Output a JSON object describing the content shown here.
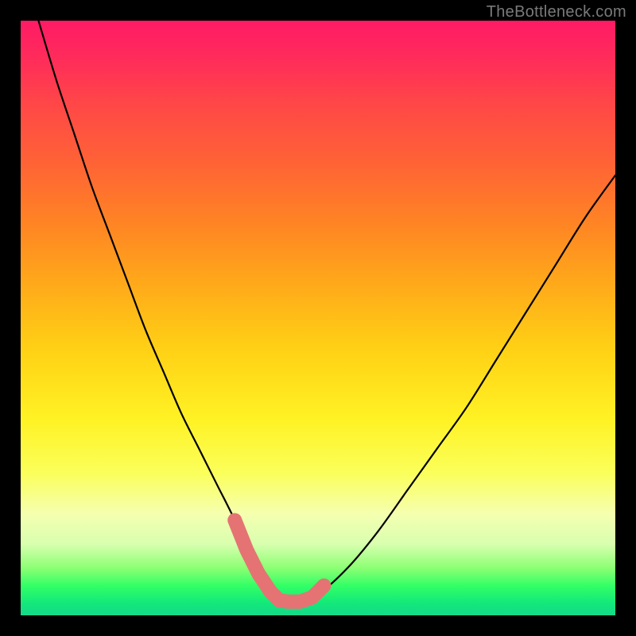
{
  "watermark": "TheBottleneck.com",
  "colors": {
    "page_bg": "#000000",
    "curve": "#000000",
    "marker": "#e57373",
    "watermark": "#7a7a7a"
  },
  "chart_data": {
    "type": "line",
    "title": "",
    "xlabel": "",
    "ylabel": "",
    "xlim": [
      0,
      100
    ],
    "ylim": [
      0,
      100
    ],
    "grid": false,
    "legend": false,
    "series": [
      {
        "name": "bottleneck-curve",
        "x": [
          3,
          6,
          9,
          12,
          15,
          18,
          21,
          24,
          27,
          30,
          33,
          36,
          38,
          40,
          42,
          43.5,
          45,
          47,
          50,
          55,
          60,
          65,
          70,
          75,
          80,
          85,
          90,
          95,
          100
        ],
        "y": [
          100,
          90,
          81,
          72,
          64,
          56,
          48,
          41,
          34,
          28,
          22,
          16,
          11,
          7,
          4,
          2.5,
          2.3,
          2.3,
          3.5,
          8,
          14,
          21,
          28,
          35,
          43,
          51,
          59,
          67,
          74
        ]
      }
    ],
    "highlighted_region": {
      "x": [
        36,
        38,
        40,
        42,
        43.5,
        45,
        47,
        49,
        51
      ],
      "y": [
        16,
        11,
        7,
        4,
        2.5,
        2.3,
        2.3,
        3.0,
        5
      ]
    }
  }
}
